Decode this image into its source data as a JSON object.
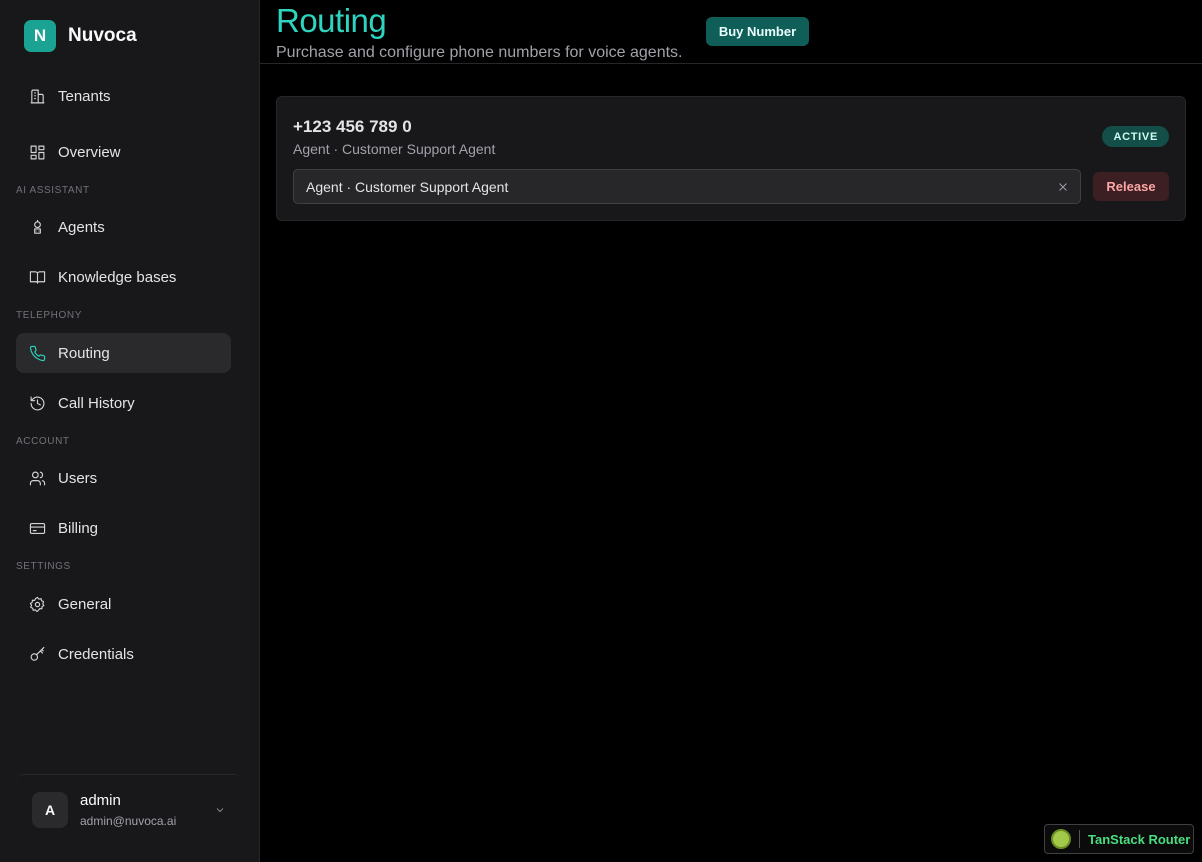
{
  "brand": {
    "logo_letter": "N",
    "name": "Nuvoca"
  },
  "sidebar": {
    "items": [
      {
        "label": "Tenants",
        "icon": "building-icon"
      },
      {
        "label": "Overview",
        "icon": "dashboard-icon"
      },
      {
        "label": "Agents",
        "icon": "bot-icon"
      },
      {
        "label": "Knowledge bases",
        "icon": "book-icon"
      },
      {
        "label": "Routing",
        "icon": "phone-icon",
        "active": true
      },
      {
        "label": "Call History",
        "icon": "history-icon"
      },
      {
        "label": "Users",
        "icon": "users-icon"
      },
      {
        "label": "Billing",
        "icon": "credit-card-icon"
      },
      {
        "label": "General",
        "icon": "gear-icon"
      },
      {
        "label": "Credentials",
        "icon": "key-icon"
      }
    ],
    "sections": {
      "ai_assistant": "AI ASSISTANT",
      "telephony": "TELEPHONY",
      "account": "ACCOUNT",
      "settings": "SETTINGS"
    },
    "user": {
      "initial": "A",
      "name": "admin",
      "email": "admin@nuvoca.ai"
    }
  },
  "header": {
    "title": "Routing",
    "subtitle": "Purchase and configure phone numbers for voice agents.",
    "buy_label": "Buy Number"
  },
  "numbers": [
    {
      "number": "+123 456 789 0",
      "assignment": "Agent · Customer Support Agent",
      "status": "ACTIVE",
      "selected_agent": "Agent · Customer Support Agent",
      "release_label": "Release"
    }
  ],
  "devtools": {
    "label": "TanStack Router"
  },
  "colors": {
    "accent": "#2dd4bf",
    "brand": "#1aa393",
    "badge_bg": "#134e48",
    "danger_text": "#fca5a5"
  }
}
